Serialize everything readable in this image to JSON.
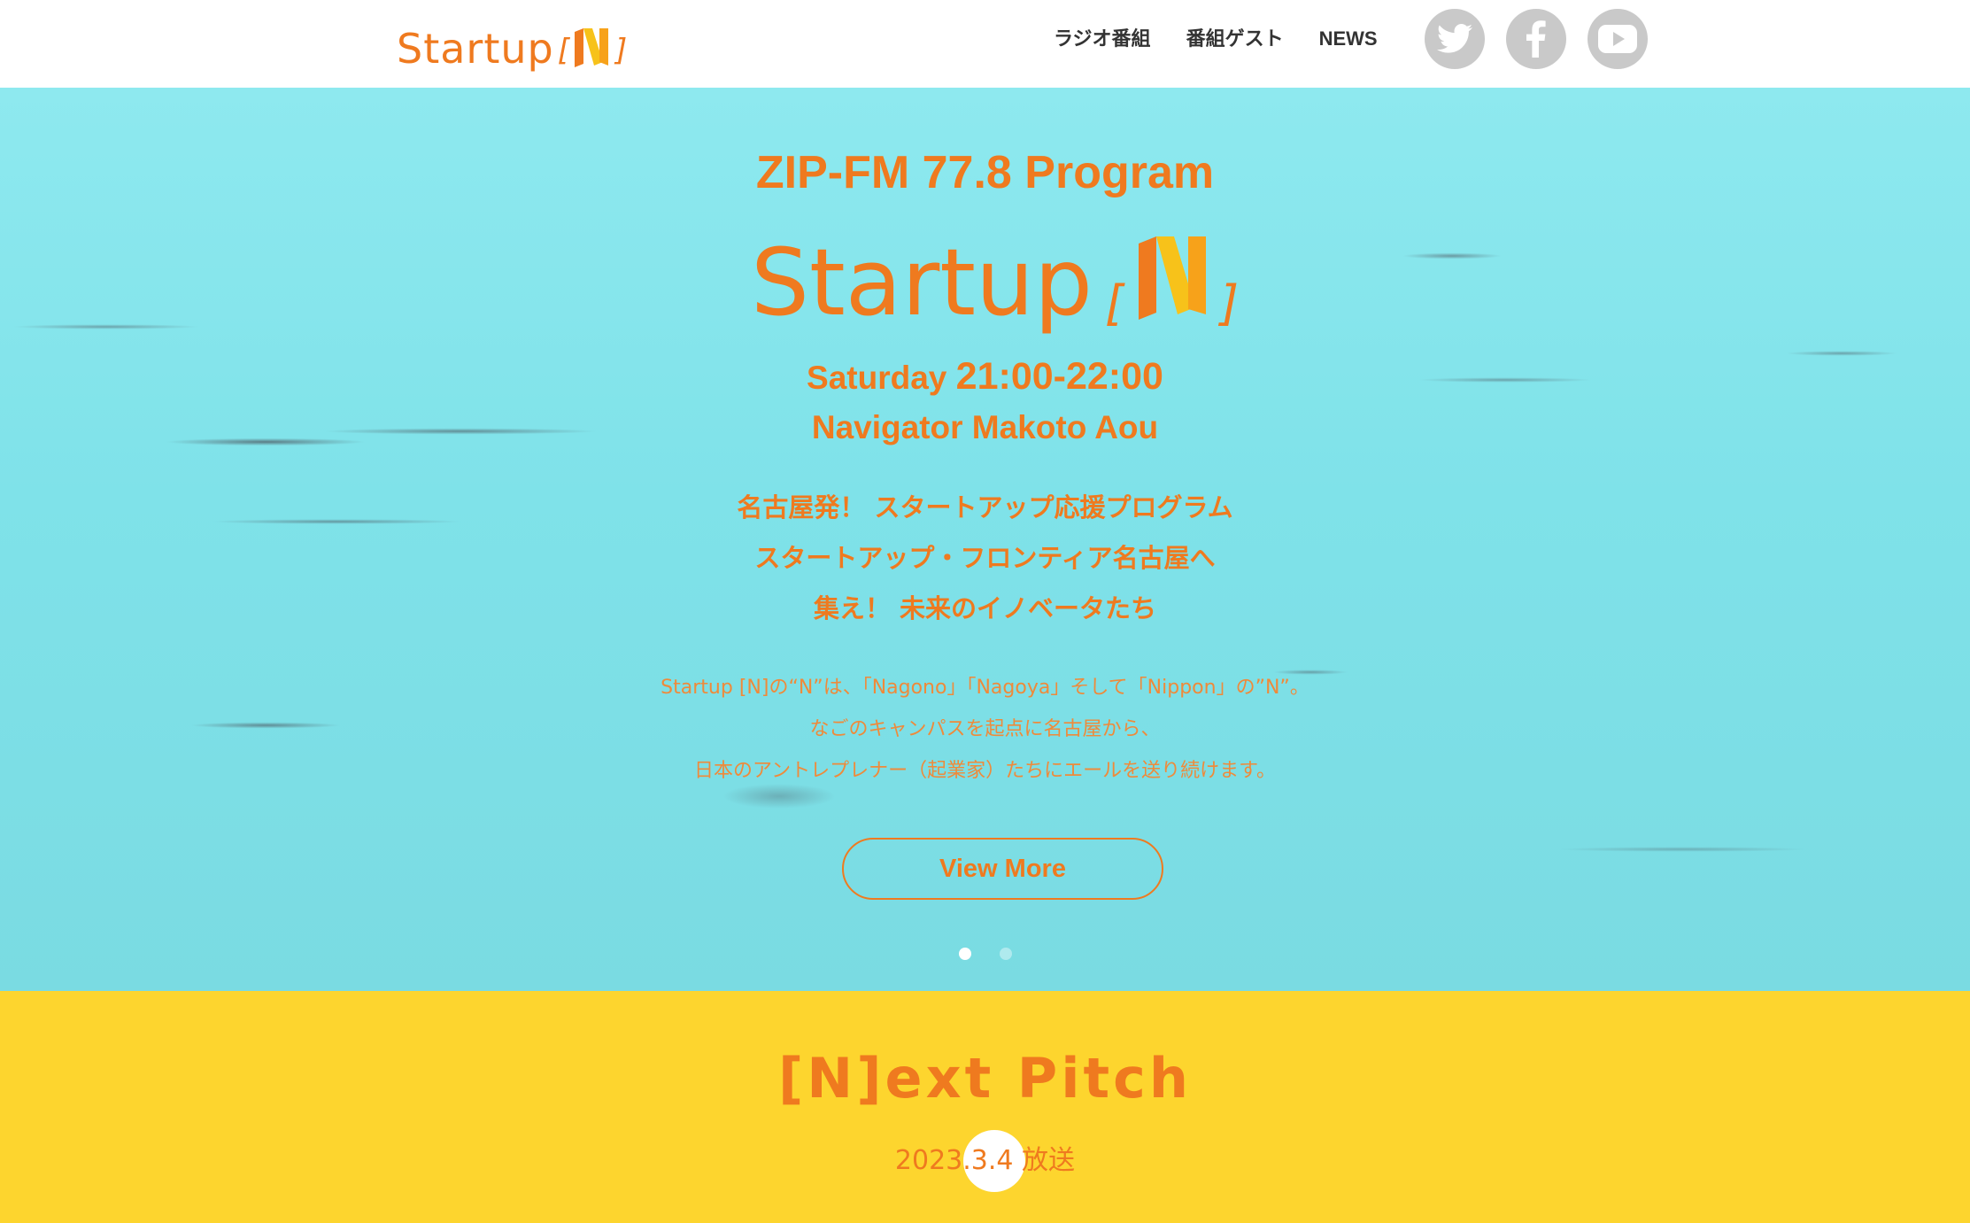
{
  "header": {
    "logo_word": "Startup",
    "logo_bracket_open": "[",
    "logo_bracket_close": "]",
    "logo_n": "N",
    "nav": [
      {
        "label": "ラジオ番組"
      },
      {
        "label": "番組ゲスト"
      },
      {
        "label": "NEWS"
      }
    ],
    "social": [
      {
        "icon": "twitter-icon"
      },
      {
        "icon": "facebook-icon"
      },
      {
        "icon": "youtube-icon"
      }
    ]
  },
  "hero": {
    "station": "ZIP-FM 77.8 Program",
    "logo_word": "Startup",
    "logo_n": "N",
    "day": "Saturday",
    "time": "21:00-22:00",
    "navigator": "Navigator Makoto Aou",
    "catch": [
      "名古屋発！ スタートアップ応援プログラム",
      "スタートアップ・フロンティア名古屋へ",
      "集え！ 未来のイノベータたち"
    ],
    "desc": [
      "Startup [N]の“N”は、「Nagono」「Nagoya」そして「Nippon」の”N”。",
      "なごのキャンパスを起点に名古屋から、",
      "日本のアントレプレナー（起業家）たちにエールを送り続けます。"
    ],
    "button_label": "View More",
    "slides_active": 1
  },
  "pitch": {
    "title": "[N]ext Pitch",
    "date": "2023.3.4 放送"
  },
  "colors": {
    "accent": "#ef7a1f",
    "hero_bg": "#7fe2e9",
    "pitch_bg": "#fdd52e",
    "social_bg": "#c9c9c9",
    "logo_n_yellow": "#f7c21a"
  }
}
